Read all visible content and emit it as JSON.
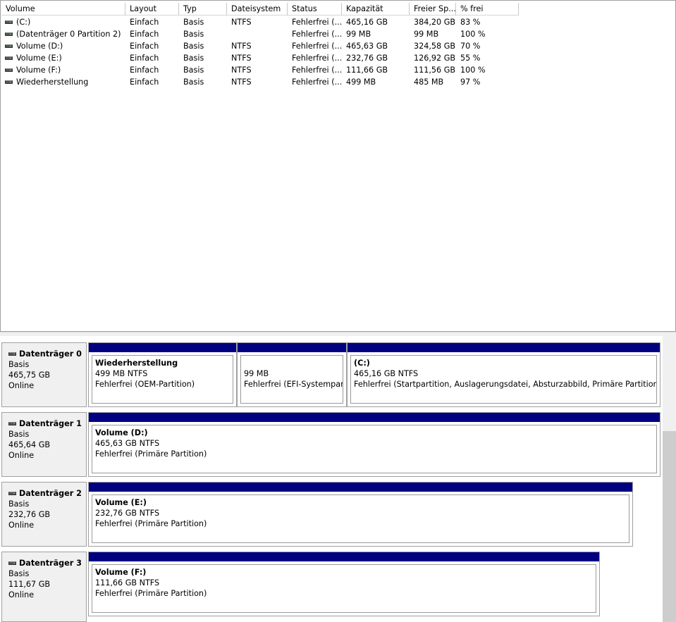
{
  "columns": [
    "Volume",
    "Layout",
    "Typ",
    "Dateisystem",
    "Status",
    "Kapazität",
    "Freier Sp...",
    "% frei"
  ],
  "volumes": [
    {
      "name": " (C:)",
      "layout": "Einfach",
      "typ": "Basis",
      "fs": "NTFS",
      "status": "Fehlerfrei (...",
      "cap": "465,16 GB",
      "free": "384,20 GB",
      "pct": "83 %"
    },
    {
      "name": "(Datenträger 0 Partition 2)",
      "layout": "Einfach",
      "typ": "Basis",
      "fs": "",
      "status": "Fehlerfrei (...",
      "cap": "99 MB",
      "free": "99 MB",
      "pct": "100 %"
    },
    {
      "name": "Volume (D:)",
      "layout": "Einfach",
      "typ": "Basis",
      "fs": "NTFS",
      "status": "Fehlerfrei (...",
      "cap": "465,63 GB",
      "free": "324,58 GB",
      "pct": "70 %"
    },
    {
      "name": "Volume (E:)",
      "layout": "Einfach",
      "typ": "Basis",
      "fs": "NTFS",
      "status": "Fehlerfrei (...",
      "cap": "232,76 GB",
      "free": "126,92 GB",
      "pct": "55 %"
    },
    {
      "name": "Volume (F:)",
      "layout": "Einfach",
      "typ": "Basis",
      "fs": "NTFS",
      "status": "Fehlerfrei (...",
      "cap": "111,66 GB",
      "free": "111,56 GB",
      "pct": "100 %"
    },
    {
      "name": "Wiederherstellung",
      "layout": "Einfach",
      "typ": "Basis",
      "fs": "NTFS",
      "status": "Fehlerfrei (...",
      "cap": "499 MB",
      "free": "485 MB",
      "pct": "97 %"
    }
  ],
  "disks": [
    {
      "name": "Datenträger 0",
      "type": "Basis",
      "size": "465,75 GB",
      "state": "Online",
      "partitions": [
        {
          "title": "Wiederherstellung",
          "size": "499 MB NTFS",
          "status": "Fehlerfrei (OEM-Partition)"
        },
        {
          "title": "",
          "size": "99 MB",
          "status": "Fehlerfrei (EFI-Systempartit"
        },
        {
          "title": " (C:)",
          "size": "465,16 GB NTFS",
          "status": "Fehlerfrei (Startpartition, Auslagerungsdatei, Absturzabbild, Primäre Partition)"
        }
      ]
    },
    {
      "name": "Datenträger 1",
      "type": "Basis",
      "size": "465,64 GB",
      "state": "Online",
      "partitions": [
        {
          "title": "Volume  (D:)",
          "size": "465,63 GB NTFS",
          "status": "Fehlerfrei (Primäre Partition)"
        }
      ]
    },
    {
      "name": "Datenträger 2",
      "type": "Basis",
      "size": "232,76 GB",
      "state": "Online",
      "partitions": [
        {
          "title": "Volume  (E:)",
          "size": "232,76 GB NTFS",
          "status": "Fehlerfrei (Primäre Partition)"
        }
      ]
    },
    {
      "name": "Datenträger 3",
      "type": "Basis",
      "size": "111,67 GB",
      "state": "Online",
      "partitions": [
        {
          "title": "Volume  (F:)",
          "size": "111,66 GB NTFS",
          "status": "Fehlerfrei (Primäre Partition)"
        }
      ]
    }
  ],
  "colors": {
    "partition_bar": "#000080",
    "panel_bg": "#f0f0f0"
  },
  "icons": {
    "disk": "disk-drive-icon"
  }
}
